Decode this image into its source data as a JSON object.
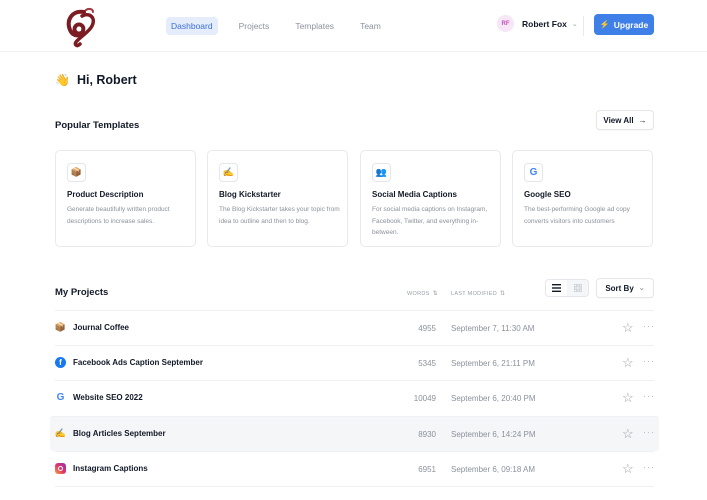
{
  "header": {
    "nav": [
      "Dashboard",
      "Projects",
      "Templates",
      "Team"
    ],
    "user": {
      "initials": "RF",
      "name": "Robert Fox"
    },
    "upgrade_label": "Upgrade"
  },
  "greeting": {
    "emoji": "👋",
    "text": "Hi, Robert"
  },
  "templates": {
    "title": "Popular Templates",
    "view_all": "View All",
    "cards": [
      {
        "icon": "box-icon",
        "glyph": "📦",
        "title": "Product Description",
        "desc": "Generate beautifully written product descriptions to increase sales."
      },
      {
        "icon": "writing-hand-icon",
        "glyph": "✍️",
        "title": "Blog Kickstarter",
        "desc": "The Blog Kickstarter takes your topic from idea to outline and then to blog."
      },
      {
        "icon": "people-icon",
        "glyph": "👥",
        "title": "Social Media Captions",
        "desc": "For social media captions on Instagram, Facebook, Twitter, and everything in-between."
      },
      {
        "icon": "google-icon",
        "glyph": "G",
        "title": "Google SEO",
        "desc": "The best-performing Google ad copy converts visitors into customers"
      }
    ]
  },
  "projects": {
    "title": "My Projects",
    "col_words": "WORDS",
    "col_modified": "LAST MODIFIED",
    "sort_label": "Sort By",
    "rows": [
      {
        "icon": "box-icon",
        "name": "Journal Coffee",
        "words": "4955",
        "modified": "September 7, 11:30 AM"
      },
      {
        "icon": "facebook-icon",
        "name": "Facebook Ads Caption September",
        "words": "5345",
        "modified": "September 6, 21:11 PM"
      },
      {
        "icon": "google-icon",
        "name": "Website SEO 2022",
        "words": "10049",
        "modified": "September 6, 20:40 PM"
      },
      {
        "icon": "writing-hand-icon",
        "name": "Blog Articles September",
        "words": "8930",
        "modified": "September 6, 14:24 PM"
      },
      {
        "icon": "instagram-icon",
        "name": "Instagram Captions",
        "words": "6951",
        "modified": "September 6, 09:18 AM"
      }
    ]
  },
  "colors": {
    "accent": "#3f7fe8",
    "active_nav_bg": "#e5edfb",
    "logo": "#7a1c22"
  }
}
